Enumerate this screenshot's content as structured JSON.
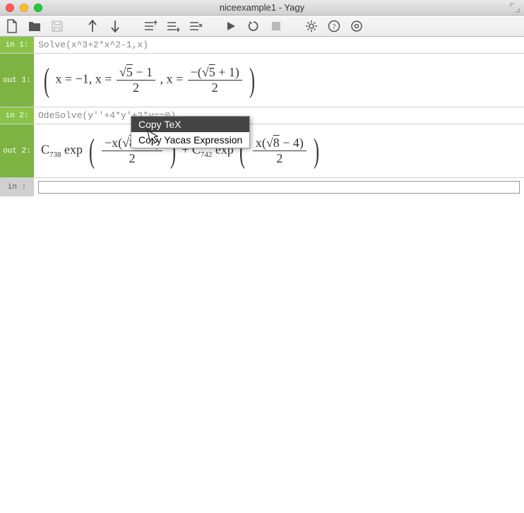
{
  "window": {
    "title": "niceexample1 - Yagy"
  },
  "cells": {
    "in1": {
      "label": "in  1:",
      "code": "Solve(x^3+2*x^2-1,x)"
    },
    "out1": {
      "label": "out 1:"
    },
    "in2": {
      "label": "in  2:",
      "code": "OdeSolve(y''+4*y'+2*y==0)"
    },
    "out2": {
      "label": "out 2:"
    },
    "in_blank": {
      "label": "in   :"
    }
  },
  "math": {
    "out1": {
      "sol1_lhs": "x = −1, x = ",
      "sol2_num_sqrt": "5",
      "sol2_num_rest": " − 1",
      "sol2_den": "2",
      "mid": ", x = ",
      "sol3_num_pre": "−(",
      "sol3_num_sqrt": "5",
      "sol3_num_post": " + 1)",
      "sol3_den": "2"
    },
    "out2": {
      "c1": "C",
      "c1sub": "738",
      "exp1": " exp",
      "t1_num_pre": "−x(",
      "t1_sqrt": "8",
      "t1_num_post": " + 4)",
      "t1_den": "2",
      "plus": " + ",
      "c2": "C",
      "c2sub": "742",
      "exp2": " exp",
      "t2_num_pre": "x(",
      "t2_sqrt": "8",
      "t2_num_post": " − 4)",
      "t2_den": "2"
    }
  },
  "context_menu": {
    "item1": "Copy TeX",
    "item2": "Copy Yacas Expression"
  }
}
